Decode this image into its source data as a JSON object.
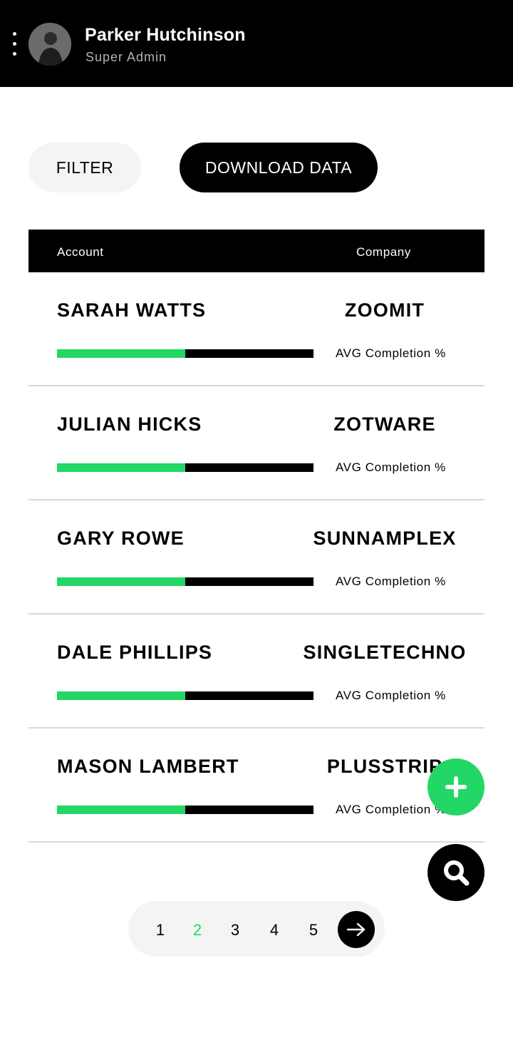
{
  "header": {
    "user_name": "Parker Hutchinson",
    "user_role": "Super Admin"
  },
  "actions": {
    "filter_label": "FILTER",
    "download_label": "DOWNLOAD DATA"
  },
  "table": {
    "columns": [
      "Account",
      "Company"
    ],
    "rows": [
      {
        "name": "SARAH WATTS",
        "company": "ZOOMIT",
        "metric_label": "AVG Completion %",
        "completion": 0.5
      },
      {
        "name": "JULIAN HICKS",
        "company": "ZOTWARE",
        "metric_label": "AVG Completion %",
        "completion": 0.5
      },
      {
        "name": "GARY ROWE",
        "company": "SUNNAMPLEX",
        "metric_label": "AVG Completion %",
        "completion": 0.5
      },
      {
        "name": "DALE PHILLIPS",
        "company": "SINGLETECHNO",
        "metric_label": "AVG Completion %",
        "completion": 0.5
      },
      {
        "name": "MASON LAMBERT",
        "company": "PLUSSTRIP",
        "metric_label": "AVG Completion %",
        "completion": 0.5
      }
    ]
  },
  "pagination": {
    "pages": [
      "1",
      "2",
      "3",
      "4",
      "5"
    ],
    "current": "2"
  },
  "colors": {
    "accent": "#22d765",
    "dark": "#000000",
    "light": "#f4f4f4"
  },
  "icons": {
    "menu": "vertical-dots-icon",
    "add": "plus-icon",
    "search": "search-icon",
    "next": "arrow-right-icon"
  }
}
